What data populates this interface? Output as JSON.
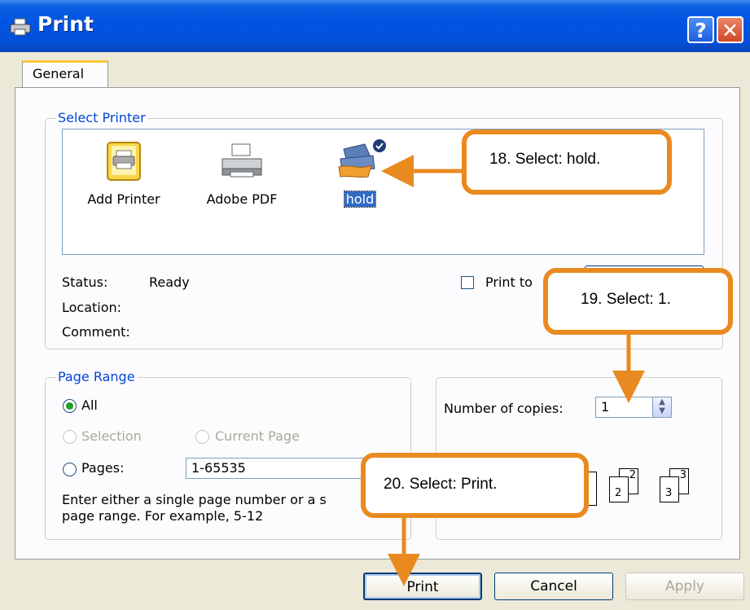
{
  "window": {
    "title": "Print",
    "help_label": "?",
    "close_label": "✕"
  },
  "tabs": [
    {
      "label": "General"
    }
  ],
  "select_printer": {
    "legend": "Select Printer",
    "printers": [
      {
        "name": "Add Printer",
        "icon": "add-printer-icon"
      },
      {
        "name": "Adobe PDF",
        "icon": "printer-icon"
      },
      {
        "name": "hold",
        "icon": "shared-printer-icon",
        "selected": true
      }
    ],
    "status_label": "Status:",
    "status_value": "Ready",
    "location_label": "Location:",
    "comment_label": "Comment:",
    "print_to_file_label": "Print to"
  },
  "page_range": {
    "legend": "Page Range",
    "all_label": "All",
    "selection_label": "Selection",
    "current_page_label": "Current Page",
    "pages_label": "Pages:",
    "pages_value": "1-65535",
    "hint_line1": "Enter either a single page number or a s",
    "hint_line2": "page range.  For example, 5-12"
  },
  "copies": {
    "label": "Number of copies:",
    "value": "1",
    "collate_labels": [
      "2",
      "2",
      "3",
      "3"
    ]
  },
  "buttons": {
    "print": "Print",
    "cancel": "Cancel",
    "apply": "Apply"
  },
  "callouts": [
    {
      "text": "18. Select:  hold."
    },
    {
      "text": "19. Select:  1."
    },
    {
      "text": "20. Select:  Print."
    }
  ],
  "colors": {
    "callout_border": "#e98a20",
    "title_bar": "#0054e3",
    "legend_text": "#0046d5"
  }
}
